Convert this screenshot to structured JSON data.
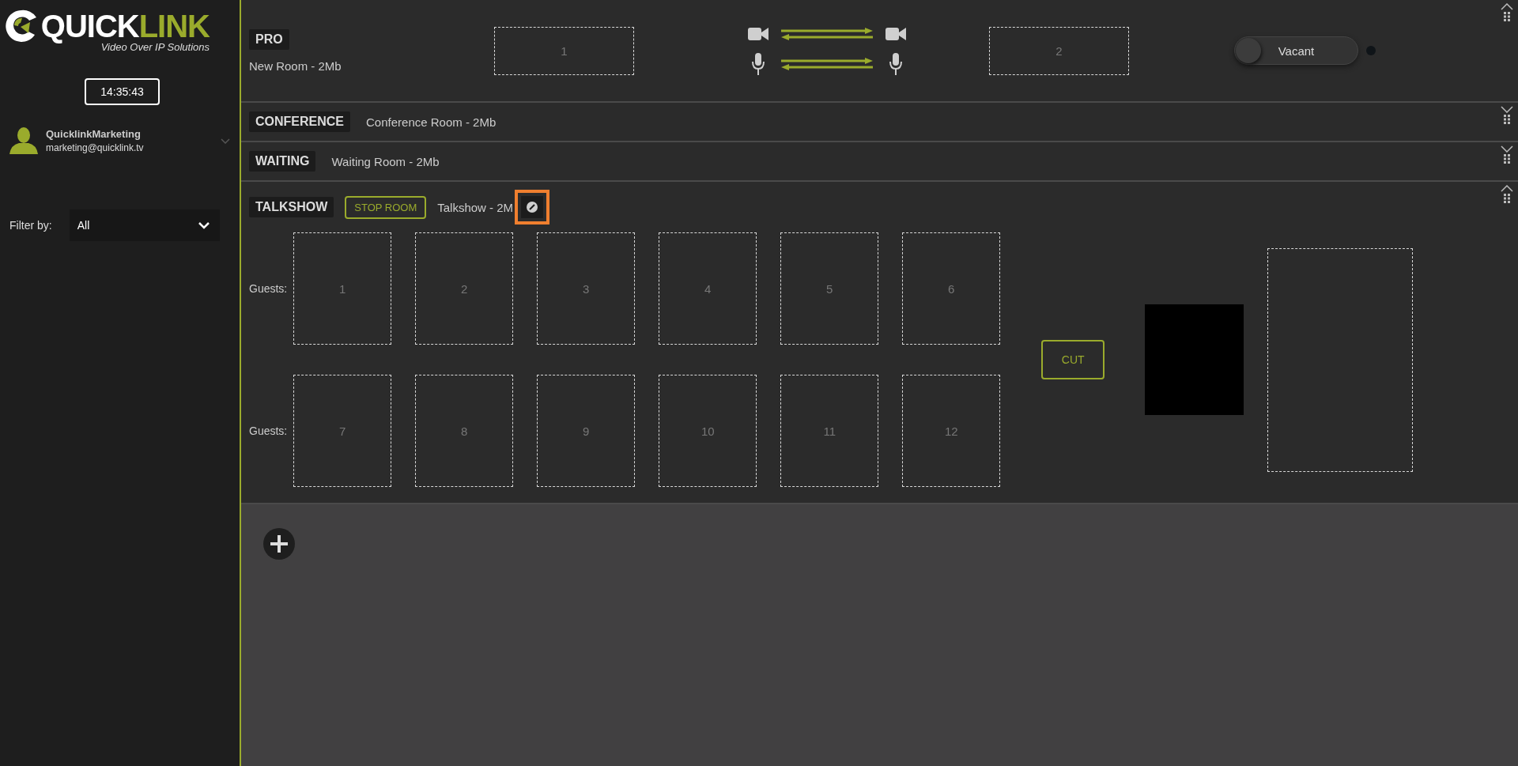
{
  "brand": {
    "word_light": "QUICK",
    "word_accent": "LINK",
    "tagline": "Video Over IP Solutions"
  },
  "clock": "14:35:43",
  "user": {
    "name": "QuicklinkMarketing",
    "email": "marketing@quicklink.tv"
  },
  "filter": {
    "label": "Filter by:",
    "value": "All"
  },
  "rooms": [
    {
      "kind": "pro",
      "tag": "PRO",
      "name": "New Room - 2Mb",
      "expanded": true,
      "slots": [
        "1",
        "2"
      ],
      "status": {
        "label": "Vacant",
        "on": false
      }
    },
    {
      "kind": "basic",
      "tag": "CONFERENCE",
      "name": "Conference Room - 2Mb",
      "expanded": false
    },
    {
      "kind": "basic",
      "tag": "WAITING",
      "name": "Waiting Room - 2Mb",
      "expanded": false
    },
    {
      "kind": "talkshow",
      "tag": "TALKSHOW",
      "action": "STOP ROOM",
      "name": "Talkshow - 2M",
      "expanded": true,
      "cut": "CUT",
      "guest_rows": [
        {
          "label": "Guests:",
          "slots": [
            "1",
            "2",
            "3",
            "4",
            "5",
            "6"
          ]
        },
        {
          "label": "Guests:",
          "slots": [
            "7",
            "8",
            "9",
            "10",
            "11",
            "12"
          ]
        }
      ]
    }
  ]
}
